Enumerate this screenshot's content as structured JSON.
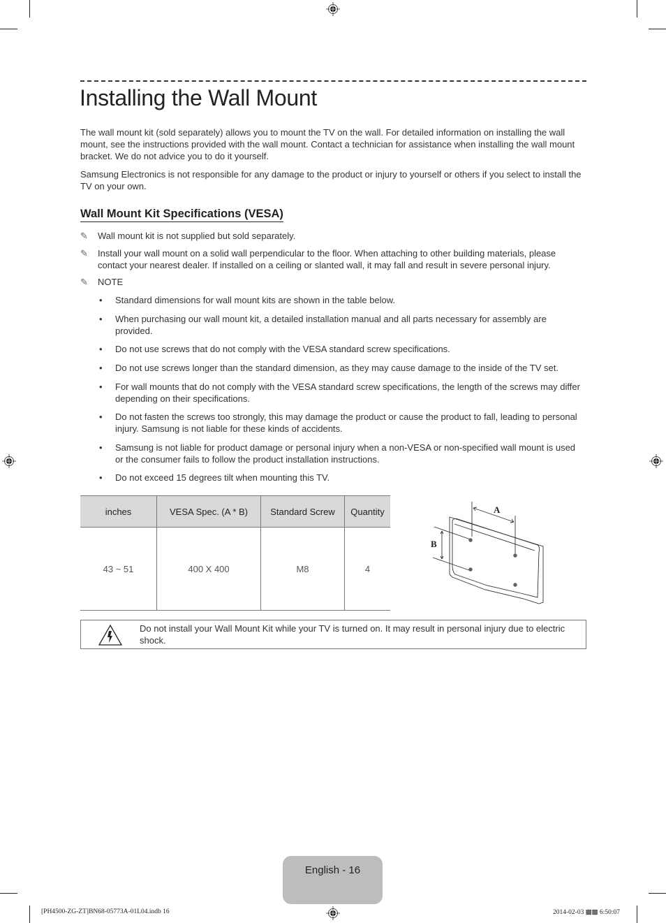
{
  "page": {
    "title": "Installing the Wall Mount",
    "intro_paragraphs": [
      "The wall mount kit (sold separately) allows you to mount the TV on the wall. For detailed information on installing the wall mount, see the instructions provided with the wall mount. Contact a technician for assistance when installing the wall mount bracket. We do not advice you to do it yourself.",
      "Samsung Electronics is not responsible for any damage to the product or injury to yourself or others if you select to install the TV on your own."
    ],
    "section_heading": "Wall Mount Kit Specifications (VESA)",
    "notes": [
      "Wall mount kit is not supplied but sold separately.",
      "Install your wall mount on a solid wall perpendicular to the floor. When attaching to other building materials, please contact your nearest dealer. If installed on a ceiling or slanted wall, it may fall and result in severe personal injury.",
      "NOTE"
    ],
    "bullets": [
      "Standard dimensions for wall mount kits are shown in the table below.",
      "When purchasing our wall mount kit, a detailed installation manual and all parts necessary for assembly are provided.",
      "Do not use screws that do not comply with the VESA standard screw specifications.",
      "Do not use screws longer than the standard dimension, as they may cause damage to the inside of the TV set.",
      "For wall mounts that do not comply with the VESA standard screw specifications, the length of the screws may differ depending on their specifications.",
      "Do not fasten the screws too strongly, this may damage the product or cause the product to fall, leading to personal injury. Samsung is not liable for these kinds of accidents.",
      "Samsung is not liable for product damage or personal injury when a non-VESA or non-specified wall mount is used or the consumer fails to follow the product installation instructions.",
      "Do not exceed 15 degrees tilt when mounting this TV."
    ],
    "table": {
      "headers": [
        "inches",
        "VESA Spec. (A * B)",
        "Standard Screw",
        "Quantity"
      ],
      "rows": [
        [
          "43 ~ 51",
          "400 X 400",
          "M8",
          "4"
        ]
      ]
    },
    "diagram_labels": {
      "a": "A",
      "b": "B"
    },
    "warning": "Do not install your Wall Mount Kit while your TV is turned on. It may result in personal injury due to electric shock.",
    "page_label": "English - 16",
    "footer_left": "[PH4500-ZG-ZT]BN68-05773A-01L04.indb   16",
    "footer_right": "2014-02-03   ▩▩ 6:50:07"
  }
}
